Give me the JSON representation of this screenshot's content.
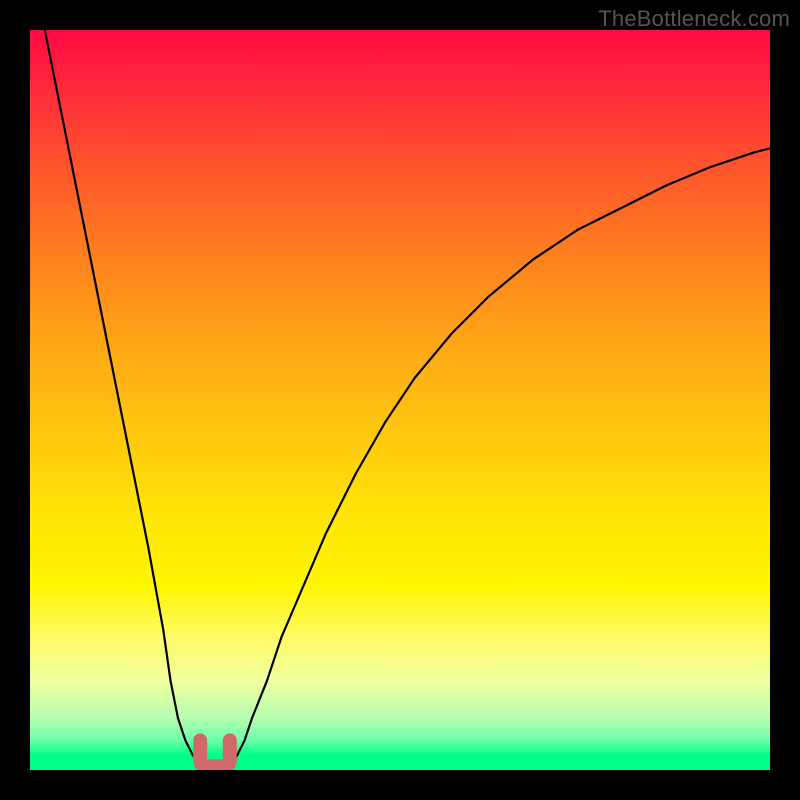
{
  "watermark": "TheBottleneck.com",
  "colors": {
    "frame": "#000000",
    "curve_stroke": "#000000",
    "marker_stroke": "#d06a6a",
    "gradient_top": "#ff0b44",
    "gradient_bottom": "#00ff88"
  },
  "chart_data": {
    "type": "line",
    "title": "",
    "xlabel": "",
    "ylabel": "",
    "xlim": [
      0,
      100
    ],
    "ylim": [
      0,
      100
    ],
    "grid": false,
    "legend": false,
    "annotations": [],
    "series": [
      {
        "name": "left-branch",
        "x": [
          2,
          4,
          6,
          8,
          10,
          12,
          14,
          16,
          18,
          19,
          20,
          21,
          22,
          23
        ],
        "y": [
          100,
          90,
          80,
          70,
          60,
          50,
          40,
          30,
          19,
          12,
          7,
          4,
          2,
          0.5
        ]
      },
      {
        "name": "right-branch",
        "x": [
          27,
          28,
          29,
          30,
          32,
          34,
          37,
          40,
          44,
          48,
          52,
          57,
          62,
          68,
          74,
          80,
          86,
          92,
          98,
          100
        ],
        "y": [
          0.5,
          2,
          4,
          7,
          12,
          18,
          25,
          32,
          40,
          47,
          53,
          59,
          64,
          69,
          73,
          76,
          79,
          81.5,
          83.5,
          84
        ]
      }
    ],
    "marker": {
      "name": "minimum-highlight",
      "shape": "u",
      "x_range": [
        23,
        27
      ],
      "y": 0.5,
      "color": "#d06a6a"
    }
  }
}
